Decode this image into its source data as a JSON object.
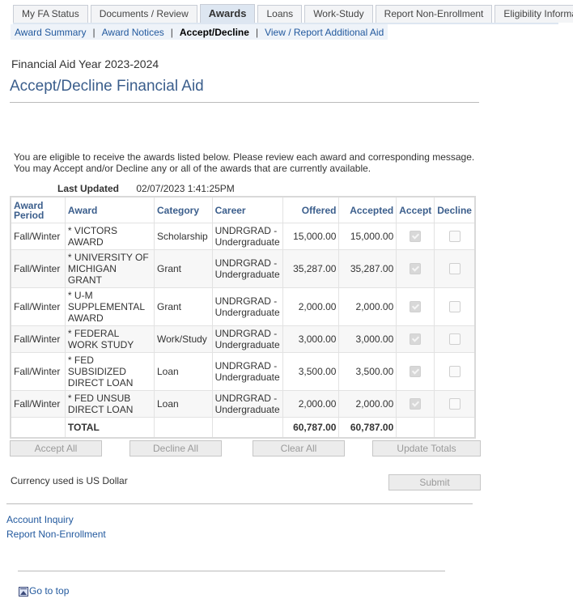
{
  "tabs": [
    {
      "label": "My FA Status",
      "active": false
    },
    {
      "label": "Documents / Review",
      "active": false
    },
    {
      "label": "Awards",
      "active": true
    },
    {
      "label": "Loans",
      "active": false
    },
    {
      "label": "Work-Study",
      "active": false
    },
    {
      "label": "Report Non-Enrollment",
      "active": false
    },
    {
      "label": "Eligibility Information",
      "active": false
    }
  ],
  "subnav": {
    "items": [
      {
        "label": "Award Summary",
        "current": false
      },
      {
        "label": "Award Notices",
        "current": false
      },
      {
        "label": "Accept/Decline",
        "current": true
      },
      {
        "label": "View / Report Additional Aid",
        "current": false
      }
    ],
    "separator": "|"
  },
  "aid_year": "Financial Aid Year 2023-2024",
  "page_title": "Accept/Decline Financial Aid",
  "intro_line1": "You are eligible to receive the awards listed below. Please review each award and corresponding message.",
  "intro_line2": "You may Accept and/or Decline any or all of the awards that are currently available.",
  "last_updated": {
    "label": "Last Updated",
    "value": "02/07/2023  1:41:25PM"
  },
  "table": {
    "headers": {
      "period": "Award Period",
      "award": "Award",
      "category": "Category",
      "career": "Career",
      "offered": "Offered",
      "accepted": "Accepted",
      "accept": "Accept",
      "decline": "Decline"
    },
    "rows": [
      {
        "period": "Fall/Winter",
        "award": "* VICTORS AWARD",
        "category": "Scholarship",
        "career": "UNDRGRAD - Undergraduate",
        "offered": "15,000.00",
        "accepted": "15,000.00",
        "accept_checked": true,
        "decline_checked": false
      },
      {
        "period": "Fall/Winter",
        "award": "* UNIVERSITY OF MICHIGAN GRANT",
        "category": "Grant",
        "career": "UNDRGRAD - Undergraduate",
        "offered": "35,287.00",
        "accepted": "35,287.00",
        "accept_checked": true,
        "decline_checked": false
      },
      {
        "period": "Fall/Winter",
        "award": "* U-M SUPPLEMENTAL AWARD",
        "category": "Grant",
        "career": "UNDRGRAD - Undergraduate",
        "offered": "2,000.00",
        "accepted": "2,000.00",
        "accept_checked": true,
        "decline_checked": false
      },
      {
        "period": "Fall/Winter",
        "award": "* FEDERAL WORK STUDY",
        "category": "Work/Study",
        "career": "UNDRGRAD - Undergraduate",
        "offered": "3,000.00",
        "accepted": "3,000.00",
        "accept_checked": true,
        "decline_checked": false
      },
      {
        "period": "Fall/Winter",
        "award": "* FED SUBSIDIZED DIRECT LOAN",
        "category": "Loan",
        "career": "UNDRGRAD - Undergraduate",
        "offered": "3,500.00",
        "accepted": "3,500.00",
        "accept_checked": true,
        "decline_checked": false
      },
      {
        "period": "Fall/Winter",
        "award": "* FED UNSUB DIRECT LOAN",
        "category": "Loan",
        "career": "UNDRGRAD - Undergraduate",
        "offered": "2,000.00",
        "accepted": "2,000.00",
        "accept_checked": true,
        "decline_checked": false
      }
    ],
    "total": {
      "label": "TOTAL",
      "offered": "60,787.00",
      "accepted": "60,787.00"
    }
  },
  "buttons": {
    "accept_all": "Accept All",
    "decline_all": "Decline All",
    "clear_all": "Clear All",
    "update_totals": "Update Totals",
    "submit": "Submit"
  },
  "currency_note": "Currency used is US Dollar",
  "links": {
    "account_inquiry": "Account Inquiry",
    "report_non_enrollment": "Report Non-Enrollment",
    "go_to_top": "Go to top"
  }
}
